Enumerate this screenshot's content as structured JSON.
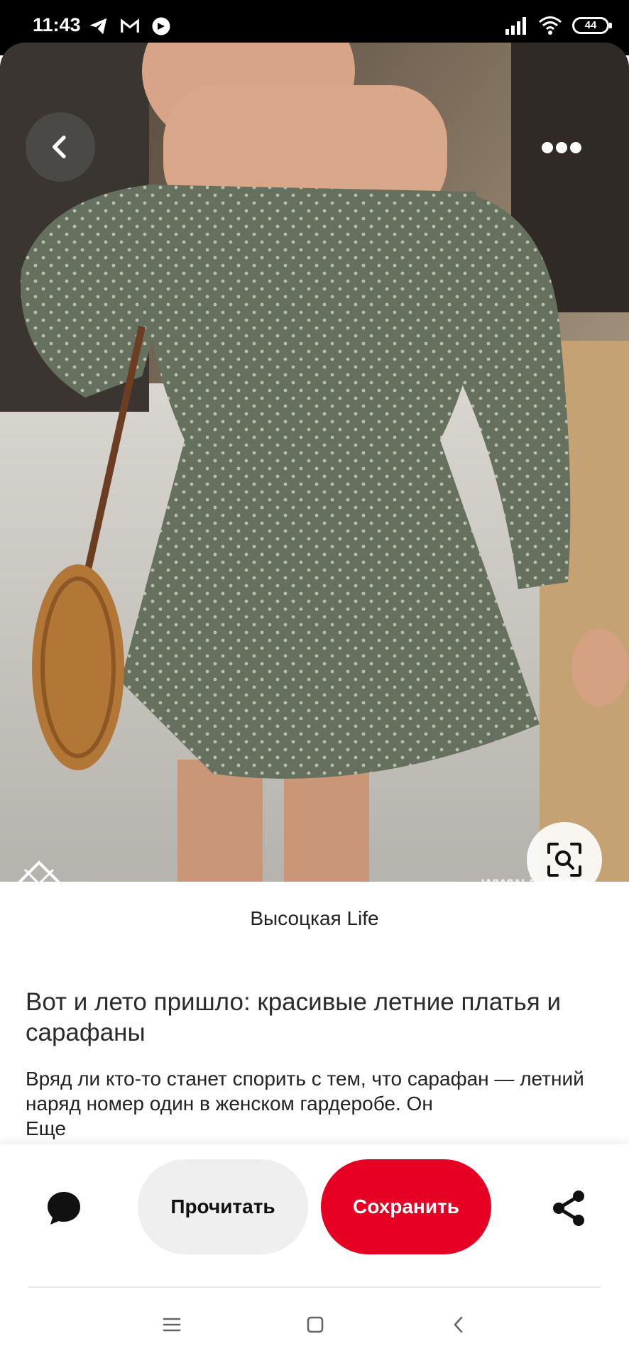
{
  "status_bar": {
    "time": "11:43",
    "left_icons": [
      "telegram-icon",
      "gmail-icon",
      "app-notification-icon"
    ],
    "right_icons": [
      "signal-icon",
      "wifi-icon",
      "battery-icon"
    ],
    "battery_level": "44"
  },
  "pin": {
    "watermark": "www.jvlife.ru",
    "source": "Высоцкая Life",
    "title": "Вот и лето пришло: красивые летние платья и сарафаны",
    "description": "Вряд ли кто-то станет спорить с тем, что сарафан — летний наряд номер один в женском гардеробе. Он",
    "more_label": "Еще"
  },
  "actions": {
    "read_label": "Прочитать",
    "save_label": "Сохранить",
    "save_color": "#e60023"
  },
  "nav_bar": {
    "icons": [
      "menu-icon",
      "home-icon",
      "back-icon"
    ]
  }
}
